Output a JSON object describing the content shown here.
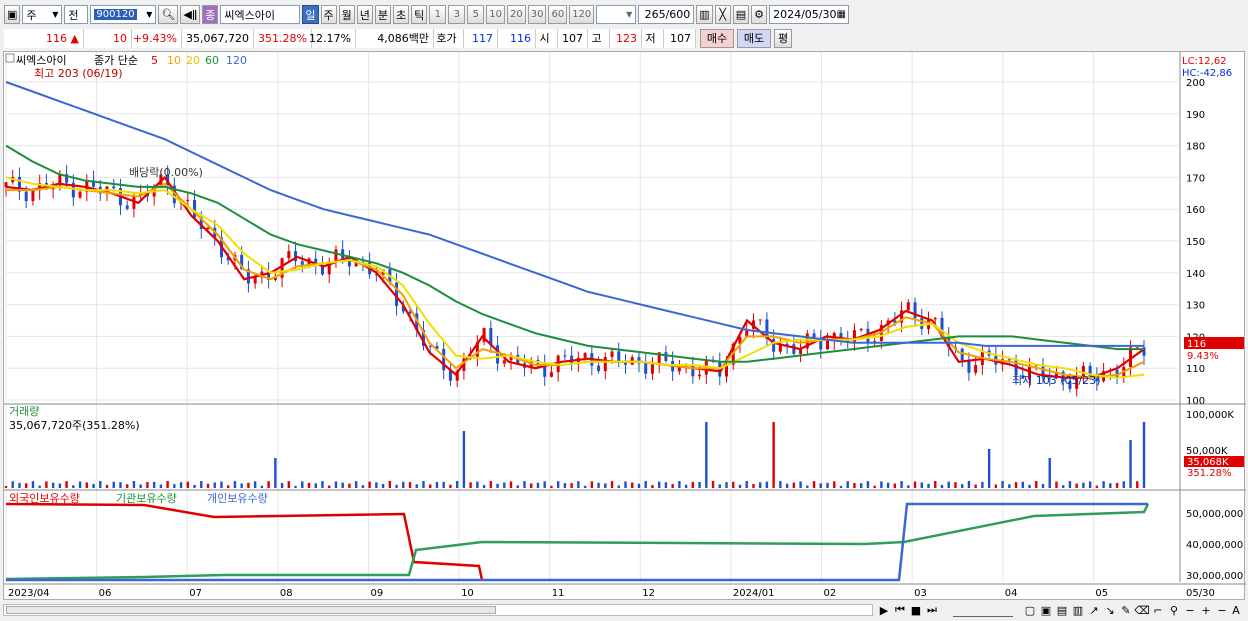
{
  "toolbar": {
    "market": "주",
    "type": "전",
    "stock_code": "900120",
    "stock_name": "씨엑스아이",
    "badge": "종",
    "period_buttons": [
      "일",
      "주",
      "월",
      "년",
      "분",
      "초",
      "틱"
    ],
    "interval_buttons": [
      "1",
      "3",
      "5",
      "10",
      "20",
      "30",
      "60",
      "120"
    ],
    "count": "265",
    "count_max": "/600",
    "date": "2024/05/30"
  },
  "quote": {
    "price": "116",
    "arrow": "▲",
    "change": "10",
    "change_pct": "+9.43%",
    "volume": "35,067,720",
    "vol_ratio": "351.28%",
    "turnover": "12.17%",
    "amount": "4,086백만",
    "hoga_label": "호가",
    "ask": "117",
    "bid": "116",
    "open_label": "시",
    "open": "107",
    "high_label": "고",
    "high": "123",
    "low_label": "저",
    "low": "107",
    "buy_label": "매수",
    "sell_label": "매도",
    "eval_label": "평"
  },
  "legend": {
    "name": "씨엑스아이",
    "ma_label": "종가 단순",
    "ma_periods": [
      "5",
      "10",
      "20",
      "60",
      "120"
    ],
    "ma_colors": [
      "#e00000",
      "#f0a000",
      "#f0e000",
      "#1a8f3a",
      "#3b66d6"
    ],
    "lc": "LC:12,62",
    "hc": "HC:-42,86"
  },
  "annotations": {
    "high": "최고 203 (06/19)",
    "low": "최저 103 (05/23)",
    "event": "배당락(0.00%)",
    "price_tag": "116",
    "pct_tag": "9.43%"
  },
  "volume_panel": {
    "title": "거래량",
    "value": "35,067,720주(351.28%)",
    "y_labels": [
      "100,000K",
      "50,000K"
    ],
    "tag": "35,068K",
    "tag_pct": "351.28%"
  },
  "holdings_panel": {
    "legend": [
      "외국인보유수량",
      "기관보유수량",
      "개인보유수량"
    ],
    "y_labels": [
      "50,000,000",
      "40,000,000",
      "30,000,000"
    ]
  },
  "chart_data": {
    "type": "line",
    "ylim": [
      100,
      200
    ],
    "y_ticks": [
      "200",
      "190",
      "180",
      "170",
      "160",
      "150",
      "140",
      "130",
      "120",
      "110",
      "100"
    ],
    "x_labels": [
      "2023/04",
      "06",
      "07",
      "08",
      "09",
      "10",
      "11",
      "12",
      "2024/01",
      "02",
      "03",
      "04",
      "05",
      "05/30"
    ],
    "series": [
      {
        "name": "5",
        "values": [
          167,
          166,
          168,
          167,
          165,
          162,
          170,
          158,
          150,
          138,
          140,
          145,
          142,
          145,
          140,
          130,
          115,
          108,
          120,
          112,
          110,
          112,
          113,
          112,
          112,
          111,
          110,
          109,
          125,
          118,
          116,
          120,
          119,
          122,
          128,
          125,
          112,
          113,
          111,
          108,
          107,
          107,
          110,
          116
        ]
      },
      {
        "name": "10",
        "values": [
          166,
          166,
          167,
          166,
          165,
          164,
          168,
          160,
          152,
          141,
          138,
          142,
          143,
          144,
          141,
          133,
          118,
          110,
          116,
          114,
          111,
          111,
          112,
          112,
          112,
          111,
          110,
          110,
          120,
          120,
          118,
          119,
          119,
          121,
          126,
          124,
          115,
          113,
          112,
          110,
          108,
          107,
          108,
          112
        ]
      },
      {
        "name": "20",
        "values": [
          170,
          168,
          167,
          166,
          166,
          165,
          166,
          160,
          155,
          146,
          140,
          141,
          143,
          144,
          142,
          136,
          124,
          114,
          113,
          114,
          112,
          111,
          112,
          112,
          112,
          111,
          111,
          110,
          114,
          118,
          119,
          119,
          119,
          120,
          123,
          124,
          118,
          115,
          113,
          111,
          110,
          108,
          107,
          108
        ]
      },
      {
        "name": "60",
        "values": [
          180,
          175,
          171,
          169,
          168,
          167,
          167,
          165,
          162,
          157,
          152,
          149,
          147,
          145,
          143,
          140,
          136,
          131,
          127,
          124,
          121,
          119,
          117,
          116,
          115,
          114,
          113,
          112,
          112,
          113,
          114,
          115,
          116,
          117,
          118,
          119,
          120,
          120,
          120,
          119,
          118,
          117,
          116,
          116
        ]
      },
      {
        "name": "120",
        "values": [
          200,
          197,
          194,
          191,
          188,
          185,
          182,
          178,
          174,
          170,
          166,
          163,
          160,
          158,
          156,
          154,
          152,
          149,
          146,
          143,
          140,
          137,
          134,
          132,
          130,
          128,
          126,
          124,
          122,
          121,
          120,
          119,
          118,
          118,
          118,
          118,
          118,
          117,
          117,
          117,
          117,
          117,
          117,
          117
        ]
      }
    ]
  }
}
